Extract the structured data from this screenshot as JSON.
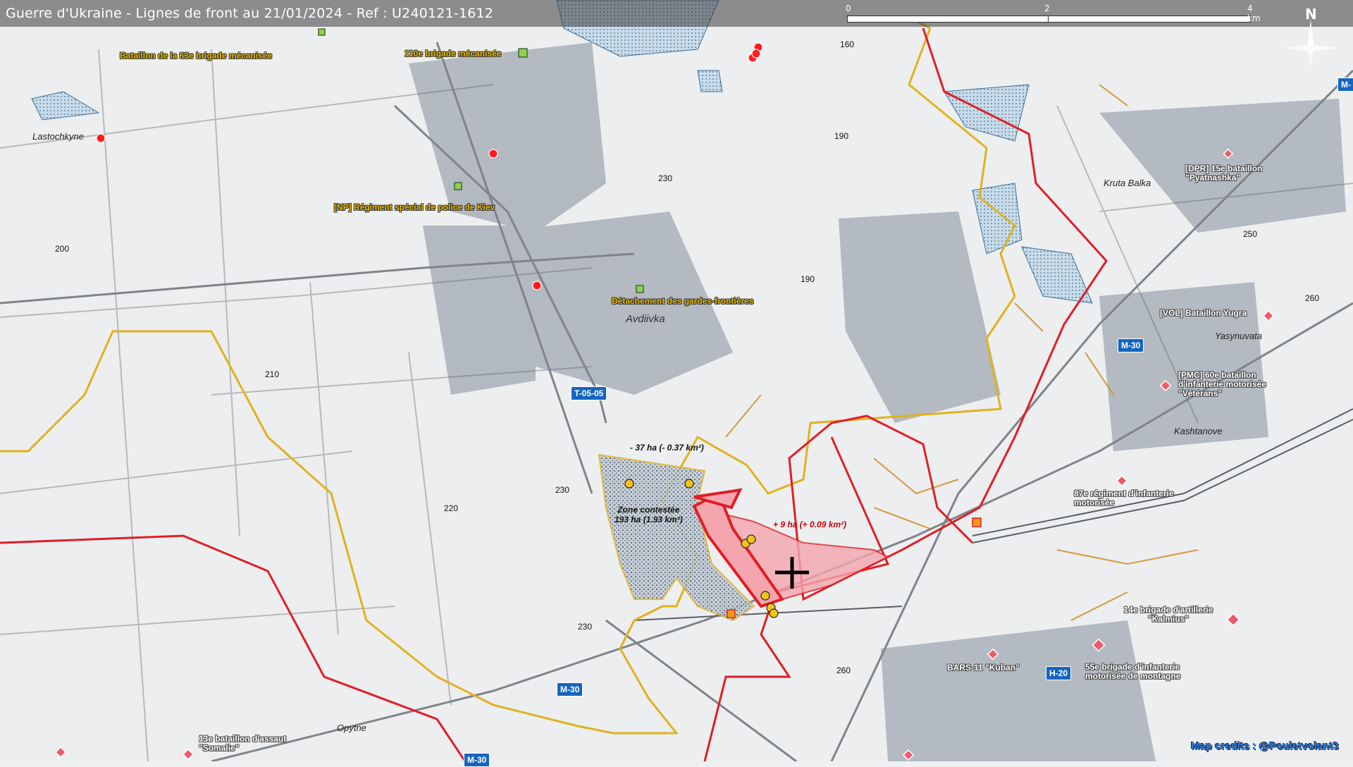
{
  "header": {
    "title": "Guerre d'Ukraine - Lignes de front au 21/01/2024 - Ref : U240121-1612"
  },
  "scale_bar": {
    "ticks": [
      "0",
      "2",
      "4 km"
    ]
  },
  "compass": {
    "label": "N",
    "icon": "compass-rose-icon"
  },
  "colors": {
    "ukraine_line": "#e0b21e",
    "russia_line": "#e01e26",
    "russian_gain": "#f5a5ad",
    "contested": "#555555",
    "road_badge": "#1565c0"
  },
  "units": {
    "bat63": "Bataillon de la 63e brigade mécanisée",
    "brig110": "110e brigade mécanisée",
    "police_kiev": "[NP] Régiment spécial de police de Kiev",
    "border_guards": "Détachement des gardes-frontières",
    "dpr15": "[DPR] 15e bataillon \"Pyatnashka\"",
    "vol_yugra": "[VOL] Bataillon Yugra",
    "pmc60": "[PMC] 60e bataillon d'infanterie motorisée \"Vétérans\"",
    "reg87": "87e régiment d'infanterie motorisée",
    "art14": "14e brigade d'artillerie \"Kalmius\"",
    "bars11": "BARS-11 \"Kuban\"",
    "brig55": "55e brigade d'infanterie motorisée de montagne",
    "bat13": "13e bataillon d'assaut \"Somalie\""
  },
  "places": {
    "lastochkyne": "Lastochkyne",
    "avdiivka": "Avdiivka",
    "kruta_balka": "Kruta Balka",
    "yasynuvata": "Yasynuvata",
    "kashtanove": "Kashtanove",
    "opytne": "Opytne"
  },
  "elevations": [
    "160",
    "190",
    "230",
    "190",
    "200",
    "210",
    "230",
    "220",
    "230",
    "260",
    "250",
    "260"
  ],
  "roads": {
    "t0505": "T-05-05",
    "m30a": "M-30",
    "m30b": "M-30",
    "m30c": "M-30",
    "h20": "H-20",
    "mtop": "M-"
  },
  "zones": {
    "loss": "- 37 ha (- 0.37 km²)",
    "contested_title": "Zone contestée",
    "contested_area": "193 ha (1.93 km²)",
    "gain": "+ 9 ha (+ 0.09 km²)"
  },
  "credits": "Map credits : @Pouletvolant3"
}
